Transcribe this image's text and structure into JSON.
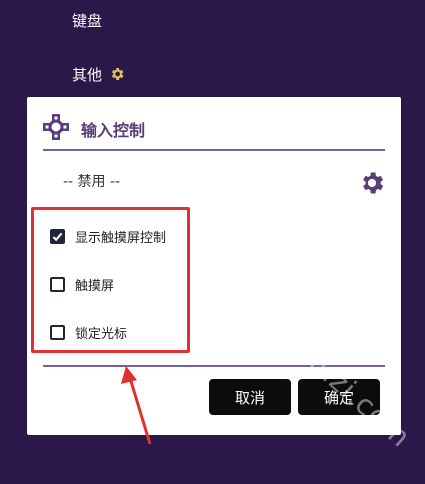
{
  "background": {
    "items": [
      {
        "label": "键盘"
      },
      {
        "label": "其他"
      }
    ]
  },
  "dialog": {
    "title": "输入控制",
    "select_value": "-- 禁用 --",
    "checkboxes": [
      {
        "label": "显示触摸屏控制",
        "checked": true
      },
      {
        "label": "触摸屏",
        "checked": false
      },
      {
        "label": "锁定光标",
        "checked": false
      }
    ],
    "cancel_label": "取消",
    "confirm_label": "确定"
  },
  "watermark": "muzi.com",
  "colors": {
    "background": "#2b1749",
    "title": "#5a3d78",
    "highlight": "#e03030",
    "button": "#0c0c0c"
  }
}
